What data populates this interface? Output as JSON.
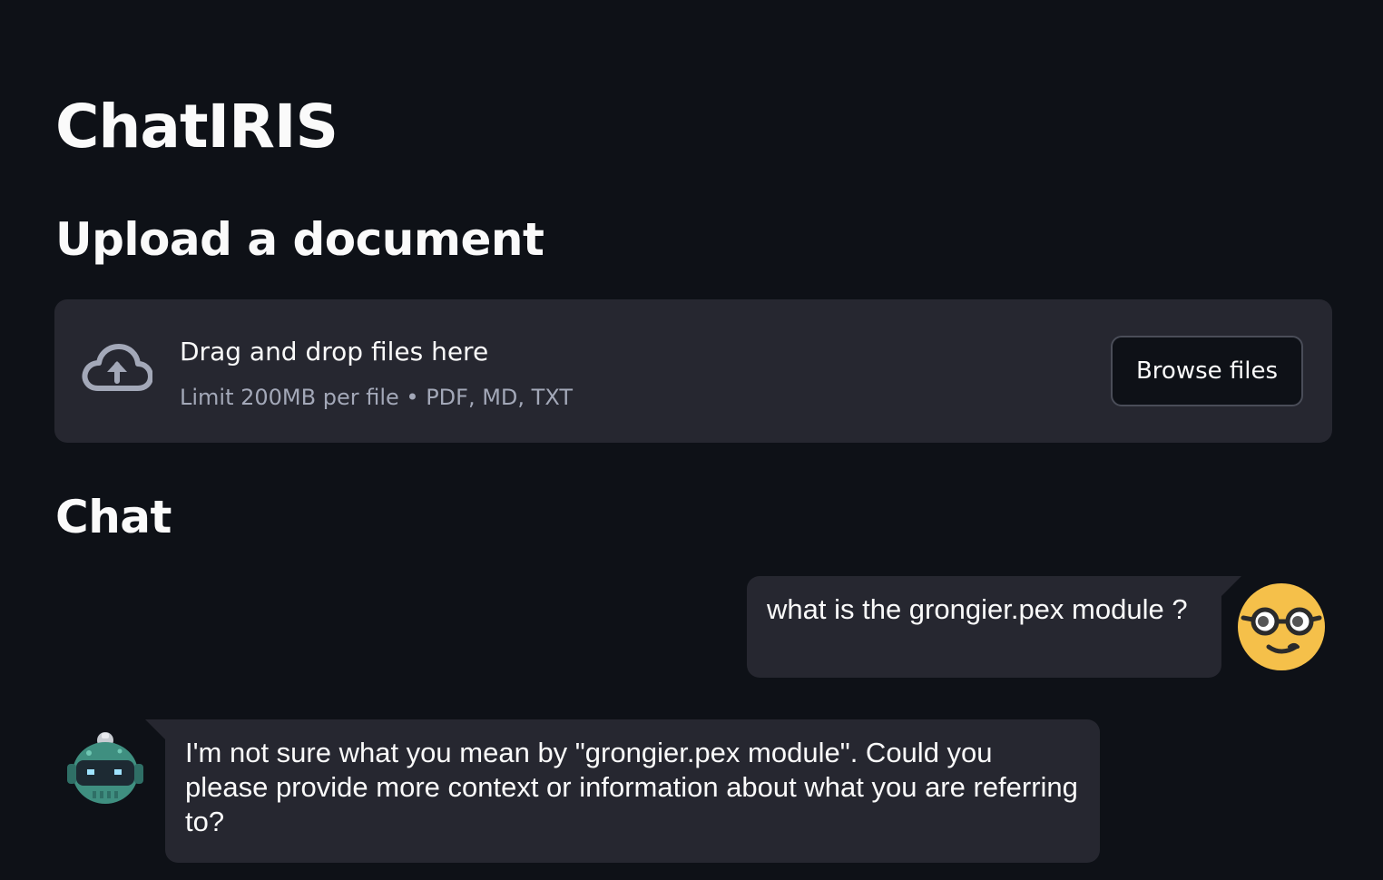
{
  "app": {
    "title": "ChatIRIS"
  },
  "upload": {
    "heading": "Upload a document",
    "icon": "cloud-upload-icon",
    "drop_text": "Drag and drop files here",
    "limit_text": "Limit 200MB per file • PDF, MD, TXT",
    "browse_label": "Browse files"
  },
  "chat": {
    "heading": "Chat",
    "messages": [
      {
        "role": "user",
        "avatar": "nerd-face-avatar",
        "text": "what is the grongier.pex module ?"
      },
      {
        "role": "assistant",
        "avatar": "robot-avatar",
        "text": "I'm not sure what you mean by \"grongier.pex module\". Could you please provide more context or information about what you are referring to?"
      }
    ]
  },
  "colors": {
    "background": "#0e1117",
    "surface": "#262730",
    "text": "#fafafa",
    "muted_text": "#a3a8b8",
    "user_avatar": "#f5c04a",
    "bot_avatar": "#3f8f80"
  }
}
